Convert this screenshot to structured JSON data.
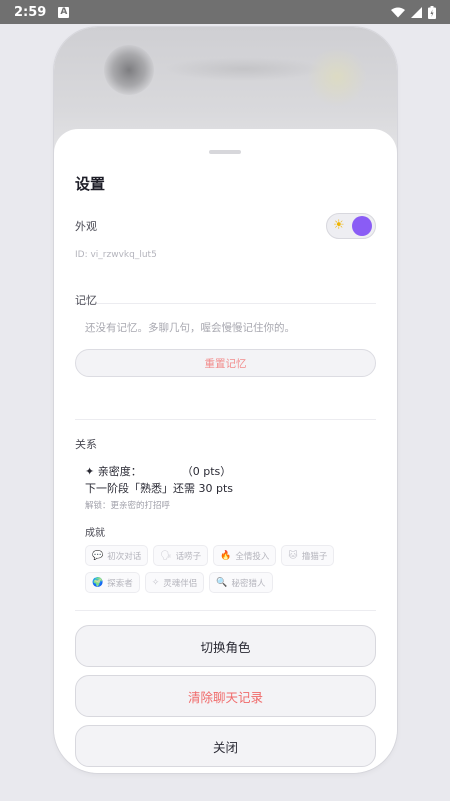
{
  "status_bar": {
    "time": "2:59",
    "notification_icon": "A"
  },
  "sheet": {
    "title": "设置",
    "appearance": {
      "label": "外观",
      "toggle_icon": "☀",
      "toggle_on": true,
      "accent": "#8a5cf5"
    },
    "id_text": "ID: vi_rzwvkq_lut5",
    "memory": {
      "label": "记忆",
      "empty_text": "还没有记忆。多聊几句，喔会慢慢记住你的。",
      "reset_label": "重置记忆"
    },
    "relationship": {
      "label": "关系",
      "intimacy_label": "✦ 亲密度：",
      "intimacy_value": "（0 pts）",
      "next_stage": "下一阶段「熟悉」还需 30 pts",
      "unlock_hint": "解锁：更亲密的打招呼",
      "achievements_label": "成就",
      "achievements_row1": [
        {
          "icon": "💬",
          "label": "初次对话"
        },
        {
          "icon": "🗣",
          "label": "话唠子"
        },
        {
          "icon": "🔥",
          "label": "全情投入"
        },
        {
          "icon": "🐱",
          "label": "撸猫子"
        }
      ],
      "achievements_row2": [
        {
          "icon": "🌍",
          "label": "探索者"
        },
        {
          "icon": "✧",
          "label": "灵魂伴侣"
        },
        {
          "icon": "🔍",
          "label": "秘密猎人"
        }
      ]
    },
    "buttons": {
      "switch_role": "切换角色",
      "clear_chat": "清除聊天记录",
      "close": "关闭"
    }
  }
}
